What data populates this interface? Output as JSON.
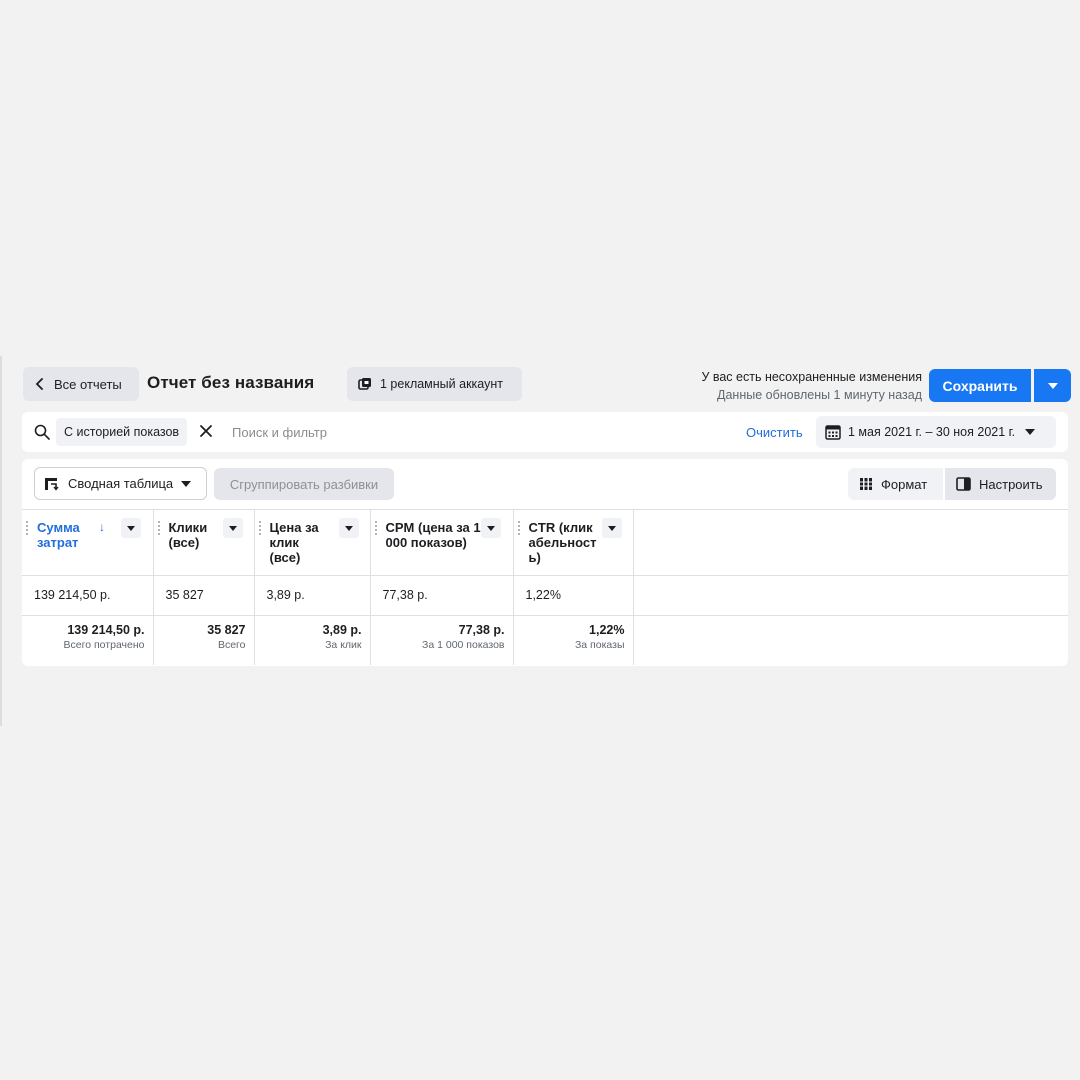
{
  "header": {
    "back_label": "Все отчеты",
    "title": "Отчет без названия",
    "account_label": "1 рекламный аккаунт",
    "status_line1": "У вас есть несохраненные изменения",
    "status_line2": "Данные обновлены 1 минуту назад",
    "save_label": "Сохранить"
  },
  "filter": {
    "chip_label": "С историей показов",
    "placeholder": "Поиск и фильтр",
    "clear_label": "Очистить",
    "date_range": "1 мая 2021 г. – 30 ноя 2021 г."
  },
  "toolbar": {
    "pivot_label": "Сводная таблица",
    "group_label": "Сгруппировать разбивки",
    "format_label": "Формат",
    "customize_label": "Настроить"
  },
  "table": {
    "columns": [
      {
        "label": "Сумма затрат",
        "sorted": true
      },
      {
        "label": "Клики (все)"
      },
      {
        "label": "Цена за клик (все)"
      },
      {
        "label": "CPM (цена за 1 000 показов)"
      },
      {
        "label": "CTR (кликабельность)"
      }
    ],
    "row": [
      "139 214,50 р.",
      "35 827",
      "3,89 р.",
      "77,38 р.",
      "1,22%"
    ],
    "totals": [
      {
        "value": "139 214,50 р.",
        "label": "Всего потрачено"
      },
      {
        "value": "35 827",
        "label": "Всего"
      },
      {
        "value": "3,89 р.",
        "label": "За клик"
      },
      {
        "value": "77,38 р.",
        "label": "За 1 000 показов"
      },
      {
        "value": "1,22%",
        "label": "За показы"
      }
    ]
  },
  "colors": {
    "accent": "#1877f2",
    "link": "#216fdb",
    "background": "#f2f2f3"
  },
  "icons": [
    "chevron-left-icon",
    "accounts-icon",
    "chevron-down-icon",
    "search-icon",
    "close-icon",
    "calendar-icon",
    "pivot-table-icon",
    "format-icon",
    "customize-icon",
    "sort-down-icon"
  ]
}
